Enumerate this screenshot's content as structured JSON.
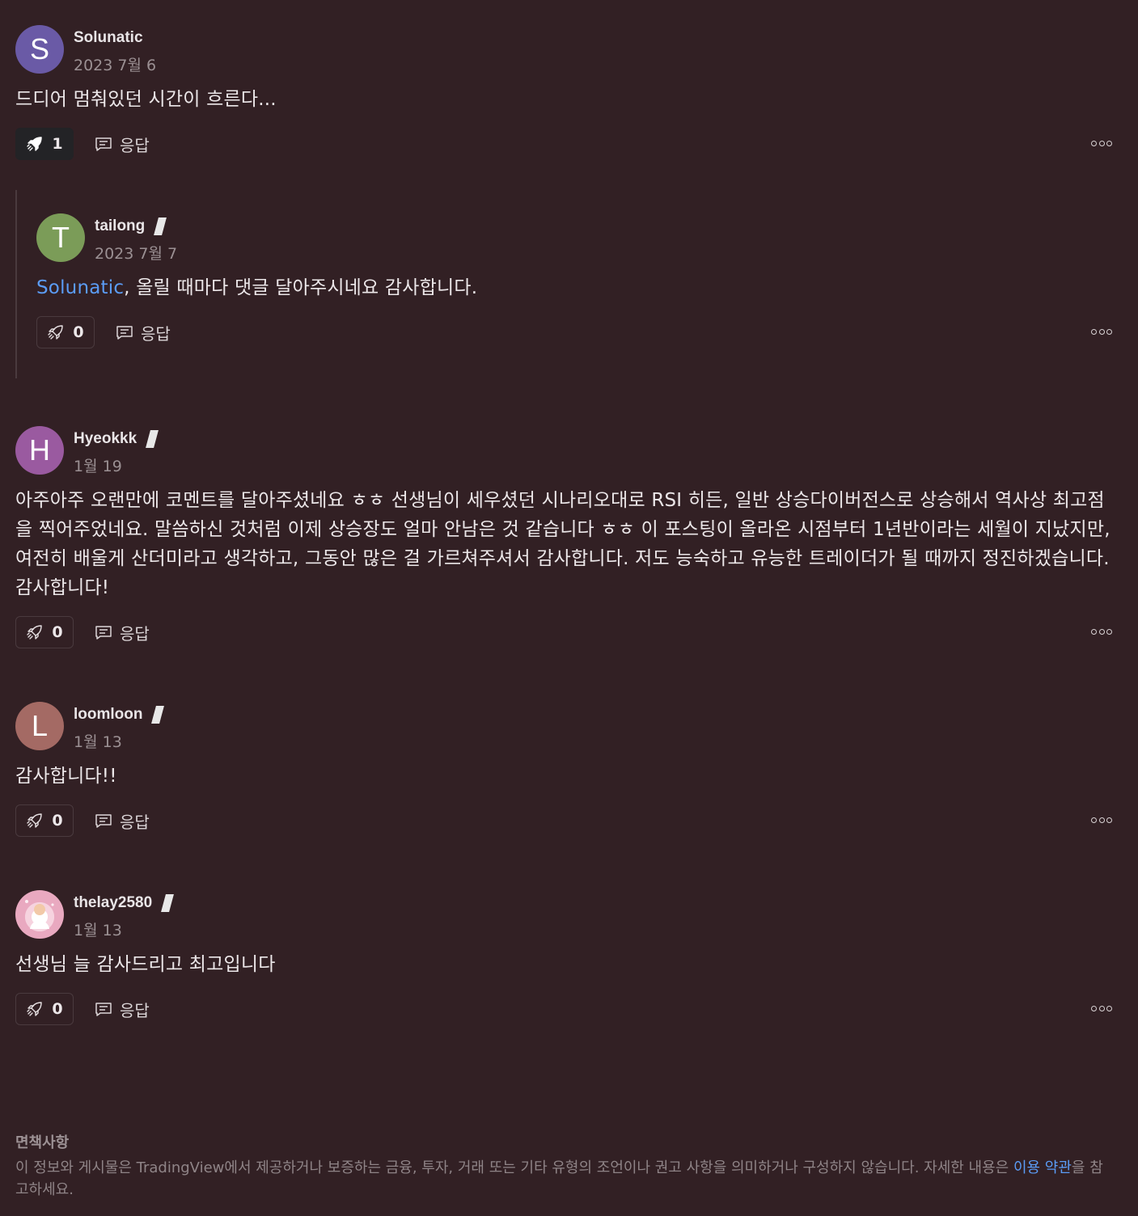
{
  "comments": [
    {
      "avatar_letter": "S",
      "avatar_color": "#6a5aa6",
      "username": "Solunatic",
      "has_badge": false,
      "date": "2023 7월 6",
      "text": "드디어 멈춰있던 시간이 흐른다...",
      "boost_count": "1",
      "boost_active": true,
      "reply_label": "응답"
    },
    {
      "avatar_letter": "T",
      "avatar_color": "#7b9c58",
      "username": "tailong",
      "has_badge": true,
      "date": "2023 7월 7",
      "mention": "Solunatic",
      "text": ", 올릴 때마다 댓글 달아주시네요 감사합니다.",
      "boost_count": "0",
      "boost_active": false,
      "reply_label": "응답"
    },
    {
      "avatar_letter": "H",
      "avatar_color": "#9a5aa0",
      "username": "Hyeokkk",
      "has_badge": true,
      "date": "1월 19",
      "text": "아주아주 오랜만에 코멘트를 달아주셨네요 ㅎㅎ 선생님이 세우셨던 시나리오대로 RSI 히든, 일반 상승다이버전스로 상승해서 역사상 최고점을 찍어주었네요. 말씀하신 것처럼 이제 상승장도 얼마 안남은 것 같습니다 ㅎㅎ 이 포스팅이 올라온 시점부터 1년반이라는 세월이 지났지만, 여전히 배울게 산더미라고 생각하고, 그동안 많은 걸 가르쳐주셔서 감사합니다. 저도 능숙하고 유능한 트레이더가 될 때까지 정진하겠습니다. 감사합니다!",
      "boost_count": "0",
      "boost_active": false,
      "reply_label": "응답"
    },
    {
      "avatar_letter": "L",
      "avatar_color": "#a46a64",
      "username": "loomloon",
      "has_badge": true,
      "date": "1월 13",
      "text": "감사합니다!!",
      "boost_count": "0",
      "boost_active": false,
      "reply_label": "응답"
    },
    {
      "avatar_letter": "",
      "avatar_color": "#e8b4c6",
      "username": "thelay2580",
      "has_badge": true,
      "date": "1월 13",
      "text": "선생님 늘 감사드리고 최고입니다",
      "boost_count": "0",
      "boost_active": false,
      "reply_label": "응답"
    }
  ],
  "icons": {
    "boost": "rocket-icon",
    "reply": "comment-icon",
    "more": "more-dots-icon"
  },
  "disclaimer": {
    "title": "면책사항",
    "text_before": "이 정보와 게시물은 TradingView에서 제공하거나 보증하는 금융, 투자, 거래 또는 기타 유형의 조언이나 권고 사항을 의미하거나 구성하지 않습니다. 자세한 내용은 ",
    "link": "이용 약관",
    "text_after": "을 참고하세요."
  }
}
